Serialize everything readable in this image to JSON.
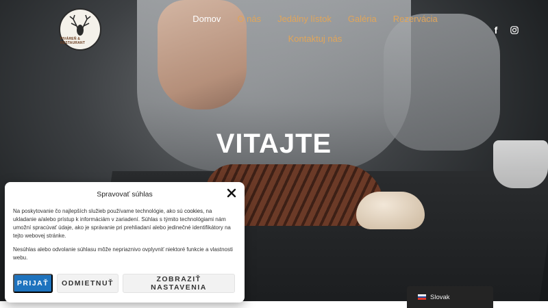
{
  "brand": {
    "logo_text": "PIVÁREŇ & RESTAURANT"
  },
  "nav": {
    "items": [
      "Domov",
      "O nás",
      "Jedálny lístok",
      "Galéria",
      "Rezervácia"
    ],
    "second_row": "Kontaktuj nás",
    "active_index": 0
  },
  "social": {
    "facebook_glyph": "f",
    "instagram_icon": "instagram-icon"
  },
  "hero": {
    "title": "VITAJTE"
  },
  "consent": {
    "title": "Spravovať súhlas",
    "text_before": "Na poskytovanie čo najlepších služieb používame technológie, ako sú ",
    "text_highlight": "cookies",
    "text_after": ", na ukladanie a/alebo prístup k informáciám v zariadení. Súhlas s týmito technológiami nám umožní spracúvať údaje, ako je správanie pri prehliadaní alebo jedinečné identifikátory na tejto webovej stránke.",
    "text2": "Nesúhlas alebo odvolanie súhlasu môže nepriaznivo ovplyvniť niektoré funkcie a vlastnosti webu.",
    "accept_label": "PRIJAŤ",
    "deny_label": "ODMIETNUŤ",
    "settings_label": "ZOBRAZIŤ NASTAVENIA"
  },
  "language": {
    "label": "Slovak"
  },
  "colors": {
    "accent": "#e0a55a",
    "primary_button": "#1e73be"
  }
}
